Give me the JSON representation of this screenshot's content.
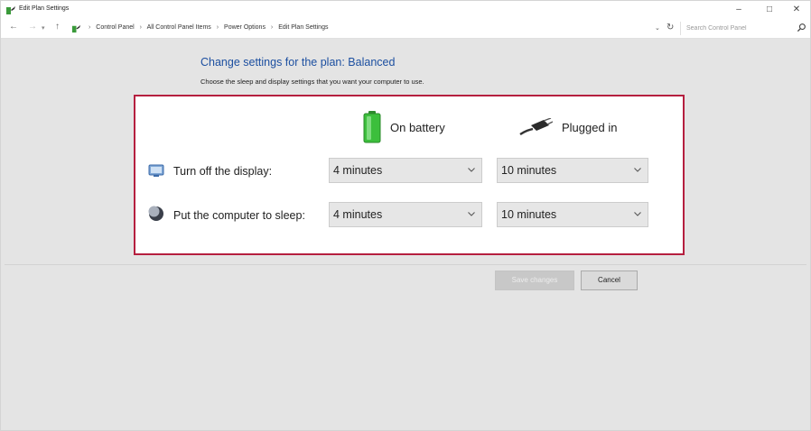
{
  "window": {
    "title": "Edit Plan Settings",
    "minimize_glyph": "–",
    "maximize_glyph": "□",
    "close_glyph": "✕"
  },
  "address": {
    "back_glyph": "←",
    "forward_glyph": "→",
    "recent_glyph": "▾",
    "up_glyph": "↑",
    "breadcrumb_sep": "›",
    "breadcrumbs": [
      "Control Panel",
      "All Control Panel Items",
      "Power Options",
      "Edit Plan Settings"
    ],
    "dropdown_glyph": "⌄",
    "refresh_glyph": "↻",
    "search_placeholder": "Search Control Panel"
  },
  "page": {
    "heading": "Change settings for the plan: Balanced",
    "subheading": "Choose the sleep and display settings that you want your computer to use."
  },
  "settings": {
    "columns": {
      "battery": "On battery",
      "plugged": "Plugged in"
    },
    "rows": [
      {
        "label": "Turn off the display:",
        "icon": "monitor-icon",
        "battery": "4 minutes",
        "plugged": "10 minutes"
      },
      {
        "label": "Put the computer to sleep:",
        "icon": "moon-icon",
        "battery": "4 minutes",
        "plugged": "10 minutes"
      }
    ]
  },
  "actions": {
    "save_label": "Save changes",
    "cancel_label": "Cancel"
  },
  "colors": {
    "heading": "#1c4fa0",
    "panel_border": "#b51f3f",
    "battery_green": "#3cbf3c"
  }
}
